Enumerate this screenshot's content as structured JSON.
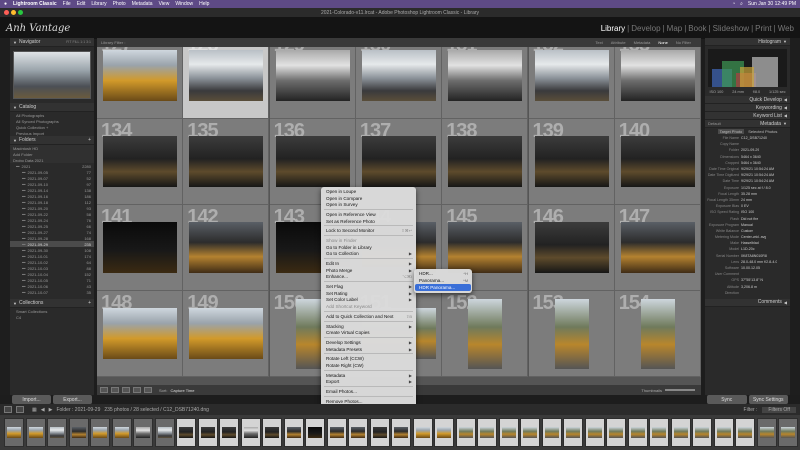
{
  "mac_menubar": {
    "app_name": "Lightroom Classic",
    "menus": [
      "File",
      "Edit",
      "Library",
      "Photo",
      "Metadata",
      "View",
      "Window",
      "Help"
    ],
    "clock": "Sun Jan 30  12:49 PM"
  },
  "window": {
    "title": "2021-Colorado-v11.lrcat - Adobe Photoshop Lightroom Classic - Library"
  },
  "identity": {
    "plate": "Anh Vantage",
    "modules": [
      "Library",
      "Develop",
      "Map",
      "Book",
      "Slideshow",
      "Print",
      "Web"
    ],
    "active_module": "Library"
  },
  "left_panel": {
    "navigator": {
      "title": "Navigator",
      "zoom": "FIT  FILL  1:1  3:1"
    },
    "catalog": {
      "title": "Catalog",
      "items": [
        "All Photographs",
        "All Synced Photographs",
        "Quick Collection +",
        "Previous Import"
      ]
    },
    "folders": {
      "title": "Folders",
      "volumes": [
        "Macintosh HD",
        "Add Folder",
        "Drobo Data 2021"
      ],
      "items": [
        {
          "label": "2021",
          "count": "2280"
        },
        {
          "label": "2021-09-05",
          "count": "77"
        },
        {
          "label": "2021-09-07",
          "count": "52"
        },
        {
          "label": "2021-09-10",
          "count": "97"
        },
        {
          "label": "2021-09-14",
          "count": "138"
        },
        {
          "label": "2021-09-16",
          "count": "186"
        },
        {
          "label": "2021-09-18",
          "count": "112"
        },
        {
          "label": "2021-09-20",
          "count": "93"
        },
        {
          "label": "2021-09-22",
          "count": "58"
        },
        {
          "label": "2021-09-24",
          "count": "76"
        },
        {
          "label": "2021-09-25",
          "count": "66"
        },
        {
          "label": "2021-09-27",
          "count": "74"
        },
        {
          "label": "2021-09-28",
          "count": "168"
        },
        {
          "label": "2021-09-29",
          "count": "235"
        },
        {
          "label": "2021-09-30",
          "count": "108"
        },
        {
          "label": "2021-10-01",
          "count": "174"
        },
        {
          "label": "2021-10-02",
          "count": "64"
        },
        {
          "label": "2021-10-03",
          "count": "88"
        },
        {
          "label": "2021-10-04",
          "count": "152"
        },
        {
          "label": "2021-10-05",
          "count": "71"
        },
        {
          "label": "2021-10-06",
          "count": "43"
        },
        {
          "label": "2021-10-07",
          "count": "35"
        }
      ],
      "selected_index": 13
    },
    "collections": {
      "title": "Collections",
      "items": [
        "Smart Collections",
        "C4"
      ]
    },
    "import_label": "Import...",
    "export_label": "Export..."
  },
  "filter_bar": {
    "title": "Library Filter :",
    "options": [
      "Text",
      "Attribute",
      "Metadata",
      "None"
    ],
    "active": "None",
    "preset": "No Filter"
  },
  "grid": {
    "cells": [
      {
        "num": "127",
        "photo": "yellow",
        "selected": false
      },
      {
        "num": "128",
        "photo": "snow",
        "selected": true
      },
      {
        "num": "129",
        "photo": "bw",
        "selected": false
      },
      {
        "num": "130",
        "photo": "snow",
        "selected": false
      },
      {
        "num": "131",
        "photo": "bw",
        "selected": false
      },
      {
        "num": "132",
        "photo": "snow",
        "selected": false
      },
      {
        "num": "133",
        "photo": "bw",
        "selected": false
      },
      {
        "num": "134",
        "photo": "dark",
        "selected": false
      },
      {
        "num": "135",
        "photo": "dark",
        "selected": false
      },
      {
        "num": "136",
        "photo": "dark",
        "selected": false
      },
      {
        "num": "137",
        "photo": "dark",
        "selected": false
      },
      {
        "num": "138",
        "photo": "dark",
        "selected": false
      },
      {
        "num": "139",
        "photo": "dark",
        "selected": false
      },
      {
        "num": "140",
        "photo": "dark",
        "selected": false
      },
      {
        "num": "141",
        "photo": "black",
        "selected": false
      },
      {
        "num": "142",
        "photo": "gold",
        "selected": false
      },
      {
        "num": "143",
        "photo": "black",
        "selected": false
      },
      {
        "num": "144",
        "photo": "gold",
        "selected": false
      },
      {
        "num": "145",
        "photo": "gold",
        "selected": false
      },
      {
        "num": "146",
        "photo": "dark",
        "selected": false
      },
      {
        "num": "147",
        "photo": "gold",
        "selected": false
      },
      {
        "num": "148",
        "photo": "yellow",
        "selected": false
      },
      {
        "num": "149",
        "photo": "yellow",
        "selected": false
      },
      {
        "num": "150",
        "photo": "road",
        "selected": false,
        "tall": true
      },
      {
        "num": "151",
        "photo": "road",
        "selected": false
      },
      {
        "num": "152",
        "photo": "road",
        "selected": false,
        "tall": true
      },
      {
        "num": "153",
        "photo": "road",
        "selected": false,
        "tall": true
      },
      {
        "num": "154",
        "photo": "road",
        "selected": false,
        "tall": true
      }
    ]
  },
  "toolbar": {
    "sort_label": "Sort:",
    "sort_value": "Capture Time",
    "thumbnails_label": "Thumbnails"
  },
  "context_menu": {
    "items": [
      {
        "label": "Open in Loupe",
        "disabled": false
      },
      {
        "label": "Open in Compare",
        "disabled": false
      },
      {
        "label": "Open in Survey",
        "disabled": false
      },
      {
        "sep": true
      },
      {
        "label": "Open in Reference View",
        "disabled": false
      },
      {
        "label": "Set as Reference Photo",
        "disabled": false
      },
      {
        "sep": true
      },
      {
        "label": "Lock to Second Monitor",
        "disabled": false,
        "shortcut": "⇧⌘↩"
      },
      {
        "sep": true
      },
      {
        "label": "Show in Finder",
        "disabled": true
      },
      {
        "label": "Go to Folder in Library",
        "disabled": false
      },
      {
        "label": "Go to Collection",
        "disabled": false,
        "submenu": true
      },
      {
        "sep": true
      },
      {
        "label": "Edit In",
        "disabled": false,
        "submenu": true
      },
      {
        "label": "Photo Merge",
        "disabled": false,
        "submenu": true,
        "highlight": true
      },
      {
        "label": "Enhance...",
        "disabled": false,
        "shortcut": "⌥⌘I"
      },
      {
        "sep": true
      },
      {
        "label": "Set Flag",
        "disabled": false,
        "submenu": true
      },
      {
        "label": "Set Rating",
        "disabled": false,
        "submenu": true
      },
      {
        "label": "Set Color Label",
        "disabled": false,
        "submenu": true
      },
      {
        "label": "Add Shortcut Keyword",
        "disabled": true
      },
      {
        "sep": true
      },
      {
        "label": "Add to Quick Collection and Next",
        "disabled": false,
        "shortcut": "⇧B"
      },
      {
        "sep": true
      },
      {
        "label": "Stacking",
        "disabled": false,
        "submenu": true
      },
      {
        "label": "Create Virtual Copies",
        "disabled": false
      },
      {
        "sep": true
      },
      {
        "label": "Develop Settings",
        "disabled": false,
        "submenu": true
      },
      {
        "label": "Metadata Presets",
        "disabled": false,
        "submenu": true
      },
      {
        "sep": true
      },
      {
        "label": "Rotate Left (CCW)",
        "disabled": false
      },
      {
        "label": "Rotate Right (CW)",
        "disabled": false
      },
      {
        "sep": true
      },
      {
        "label": "Metadata",
        "disabled": false,
        "submenu": true
      },
      {
        "label": "Export",
        "disabled": false,
        "submenu": true
      },
      {
        "sep": true
      },
      {
        "label": "Email Photos...",
        "disabled": false
      },
      {
        "sep": true
      },
      {
        "label": "Remove Photos...",
        "disabled": false
      },
      {
        "sep": true
      },
      {
        "label": "View Options...",
        "disabled": false
      }
    ]
  },
  "submenu": {
    "items": [
      {
        "label": "HDR...",
        "shortcut": "^H",
        "active": false
      },
      {
        "label": "Panorama...",
        "shortcut": "^M",
        "active": false
      },
      {
        "label": "HDR Panorama...",
        "shortcut": "",
        "active": true
      }
    ]
  },
  "right_panel": {
    "histogram_title": "Histogram",
    "histogram_info": [
      "ISO 100",
      "24 mm",
      "f/8.0",
      "1/125 sec"
    ],
    "quick_develop": "Quick Develop",
    "keywording": "Keywording",
    "keyword_list": "Keyword List",
    "metadata": "Metadata",
    "metadata_preset": "Default",
    "metadata_tabs": [
      "Target Photo",
      "Selected Photos"
    ],
    "fields": [
      {
        "k": "File Name",
        "v": "C12_DSB71240"
      },
      {
        "k": "Copy Name",
        "v": ""
      },
      {
        "k": "Folder",
        "v": "2021-09-29"
      },
      {
        "k": "Dimensions",
        "v": "5464 x 3640"
      },
      {
        "k": "Cropped",
        "v": "5464 x 3640"
      },
      {
        "k": "Date Time Original",
        "v": "9/29/21 10:54:24 AM"
      },
      {
        "k": "Date Time Digitized",
        "v": "9/29/21 10:54:24 AM"
      },
      {
        "k": "Date Time",
        "v": "9/29/21 10:54:24 AM"
      },
      {
        "k": "Exposure",
        "v": "1/125 sec at f / 8.0"
      },
      {
        "k": "Focal Length",
        "v": "35.28 mm"
      },
      {
        "k": "Focal Length 35mm",
        "v": "24 mm"
      },
      {
        "k": "Exposure Bias",
        "v": "0 EV"
      },
      {
        "k": "ISO Speed Rating",
        "v": "ISO 100"
      },
      {
        "k": "Flash",
        "v": "Did not fire"
      },
      {
        "k": "Exposure Program",
        "v": "Manual"
      },
      {
        "k": "White Balance",
        "v": "Custom"
      },
      {
        "k": "Metering Mode",
        "v": "Center-wtd. avg"
      },
      {
        "k": "Make",
        "v": "Hasselblad"
      },
      {
        "k": "Model",
        "v": "L1D-20c"
      },
      {
        "k": "Serial Number",
        "v": "0K8TA8N010R8"
      },
      {
        "k": "Lens",
        "v": "28.0-48.0 mm f/2.8-4.0"
      },
      {
        "k": "Software",
        "v": "10.00.12.05"
      },
      {
        "k": "User Comment",
        "v": ""
      },
      {
        "k": "GPS",
        "v": "37°55'13.8\" N"
      },
      {
        "k": "Altitude",
        "v": "3,206.8 m"
      },
      {
        "k": "Direction",
        "v": ""
      }
    ],
    "comments": "Comments",
    "sync_label": "Sync",
    "sync_settings_label": "Sync Settings"
  },
  "filmstrip_header": {
    "pages": [
      "1",
      "2"
    ],
    "source": "Folder : 2021-09-29",
    "count": "235 photos / 28 selected / C12_DSB71240.dng",
    "filter_label": "Filter :",
    "filter_value": "Filters Off"
  }
}
